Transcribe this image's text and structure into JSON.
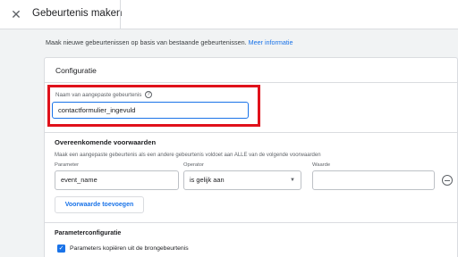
{
  "header": {
    "title": "Gebeurtenis maken",
    "close_icon": "close-icon"
  },
  "intro": {
    "text": "Maak nieuwe gebeurtenissen op basis van bestaande gebeurtenissen.",
    "link": "Meer informatie"
  },
  "config": {
    "title": "Configuratie",
    "name_label": "Naam van aangepaste gebeurtenis",
    "name_help_icon": "help-icon",
    "name_value": "contactformulier_ingevuld",
    "highlight_color": "#e0111b"
  },
  "conditions": {
    "title": "Overeenkomende voorwaarden",
    "description": "Maak een aangepaste gebeurtenis als een andere gebeurtenis voldoet aan ALLE van de volgende voorwaarden",
    "columns": {
      "parameter": "Parameter",
      "operator": "Operator",
      "value": "Waarde"
    },
    "rows": [
      {
        "parameter": "event_name",
        "operator": "is gelijk aan",
        "value": ""
      }
    ],
    "add_button": "Voorwaarde toevoegen"
  },
  "params": {
    "title": "Parameterconfiguratie",
    "copy_label": "Parameters kopiëren uit de brongebeurtenis",
    "copy_checked": true
  },
  "colors": {
    "accent": "#1a73e8",
    "background": "#f1f3f4"
  }
}
